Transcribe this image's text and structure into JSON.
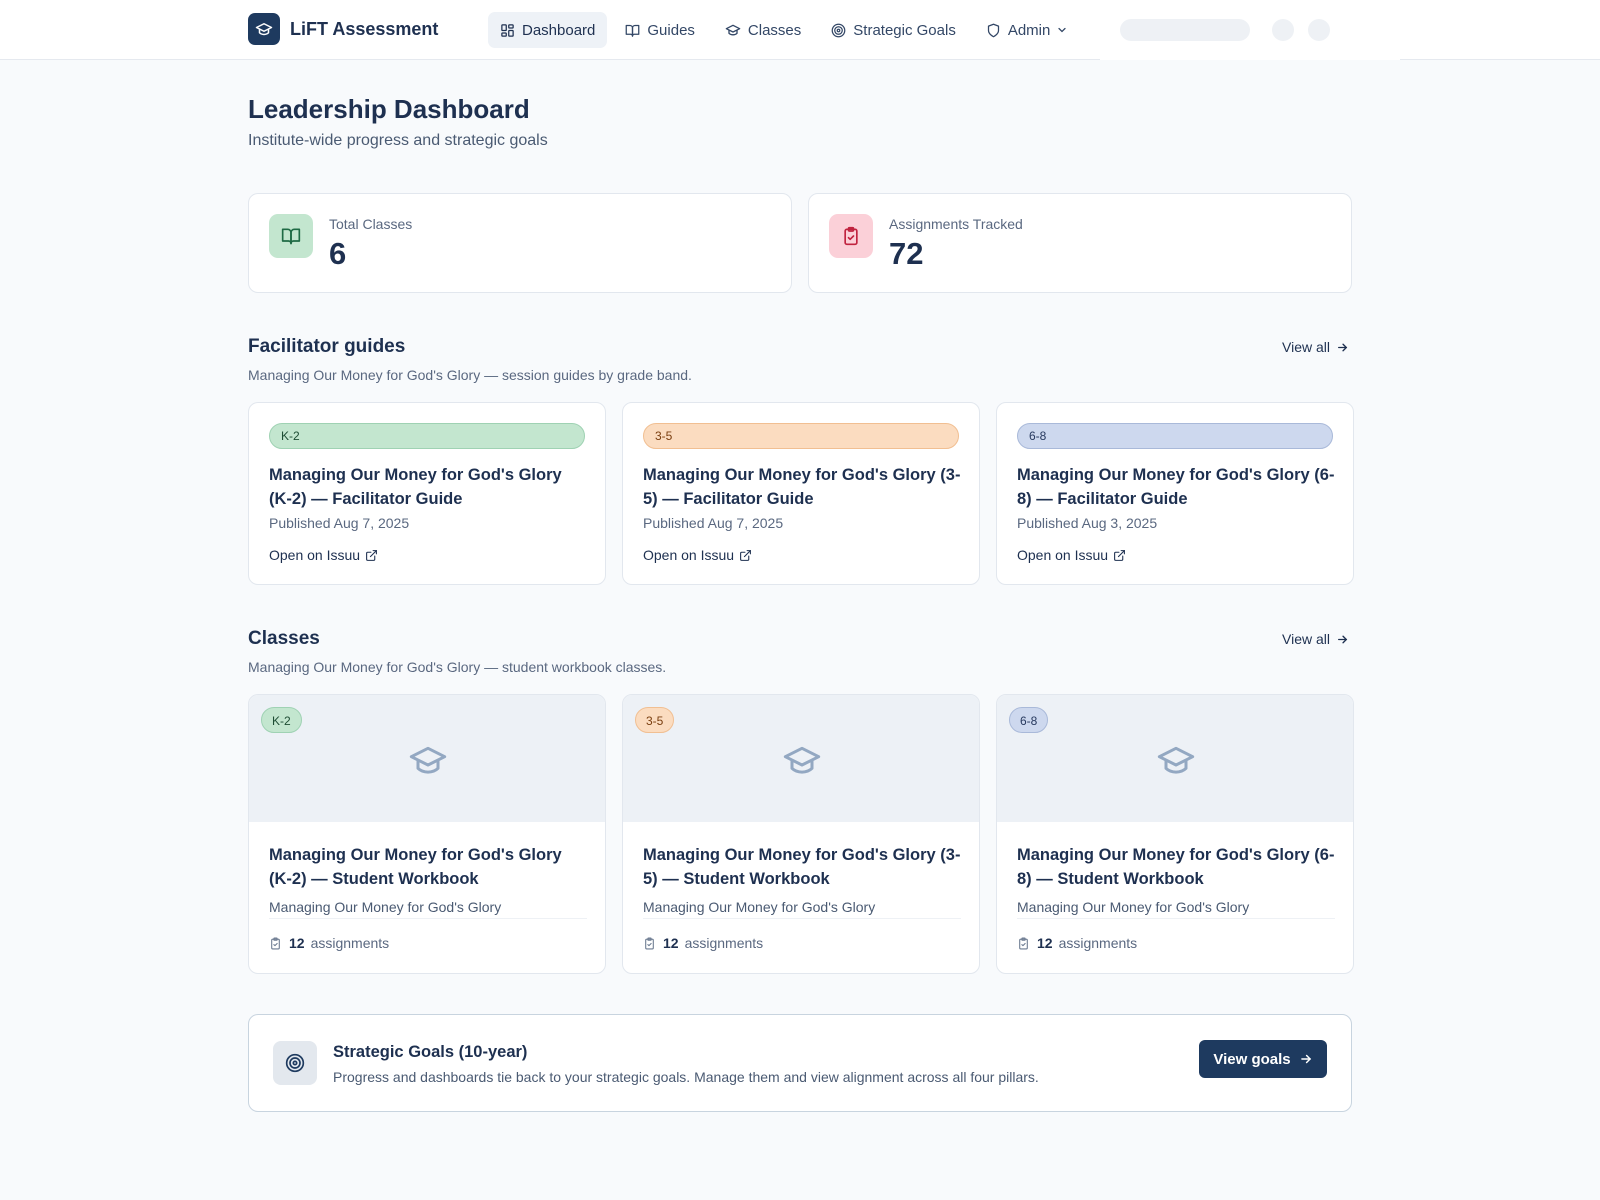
{
  "nav": {
    "brand": "LiFT Assessment",
    "links": [
      {
        "label": "Dashboard",
        "icon": "dashboard-grid-icon"
      },
      {
        "label": "Guides",
        "icon": "book-icon"
      },
      {
        "label": "Classes",
        "icon": "graduation-cap-icon"
      },
      {
        "label": "Strategic Goals",
        "icon": "target-icon"
      },
      {
        "label": "Admin",
        "icon": "shield-icon"
      }
    ]
  },
  "header": {
    "title": "Leadership Dashboard",
    "subtitle": "Institute-wide progress and strategic goals"
  },
  "stats": [
    {
      "label": "Total Classes",
      "value": "6",
      "icon": "book-open-icon",
      "color": "#c3e6cf"
    },
    {
      "label": "Assignments Tracked",
      "value": "72",
      "icon": "clipboard-check-icon",
      "color": "#fbd0d8"
    }
  ],
  "guides": {
    "title": "Facilitator guides",
    "subtitle": "Managing Our Money for God's Glory — session guides by grade band.",
    "view_all": "View all",
    "items": [
      {
        "band": "K-2",
        "band_color": "#c3e6cf",
        "band_border": "#9fd2b3",
        "title": "Managing Our Money for God's Glory (K-2) — Facilitator Guide",
        "date": "Published Aug 7, 2025",
        "link": "Open on Issuu"
      },
      {
        "band": "3-5",
        "band_color": "#fbdcc0",
        "band_border": "#f1bf92",
        "title": "Managing Our Money for God's Glory (3-5) — Facilitator Guide",
        "date": "Published Aug 7, 2025",
        "link": "Open on Issuu"
      },
      {
        "band": "6-8",
        "band_color": "#cdd8ee",
        "band_border": "#a9b9d9",
        "title": "Managing Our Money for God's Glory (6-8) — Facilitator Guide",
        "date": "Published Aug 3, 2025",
        "link": "Open on Issuu"
      }
    ]
  },
  "classes": {
    "title": "Classes",
    "subtitle": "Managing Our Money for God's Glory — student workbook classes.",
    "view_all": "View all",
    "items": [
      {
        "band": "K-2",
        "band_color": "#c3e6cf",
        "band_border": "#9fd2b3",
        "title": "Managing Our Money for God's Glory (K-2) — Student Workbook",
        "subtitle": "Managing Our Money for God's Glory",
        "count": "12",
        "count_label": "assignments"
      },
      {
        "band": "3-5",
        "band_color": "#fbdcc0",
        "band_border": "#f1bf92",
        "title": "Managing Our Money for God's Glory (3-5) — Student Workbook",
        "subtitle": "Managing Our Money for God's Glory",
        "count": "12",
        "count_label": "assignments"
      },
      {
        "band": "6-8",
        "band_color": "#cdd8ee",
        "band_border": "#a9b9d9",
        "title": "Managing Our Money for God's Glory (6-8) — Student Workbook",
        "subtitle": "Managing Our Money for God's Glory",
        "count": "12",
        "count_label": "assignments"
      }
    ]
  },
  "goals": {
    "title": "Strategic Goals (10-year)",
    "text": "Progress and dashboards tie back to your strategic goals. Manage them and view alignment across all four pillars.",
    "button": "View goals"
  },
  "colors": {
    "primary": "#1e3a5f",
    "text": "#1e3050",
    "muted": "#5a6880"
  }
}
